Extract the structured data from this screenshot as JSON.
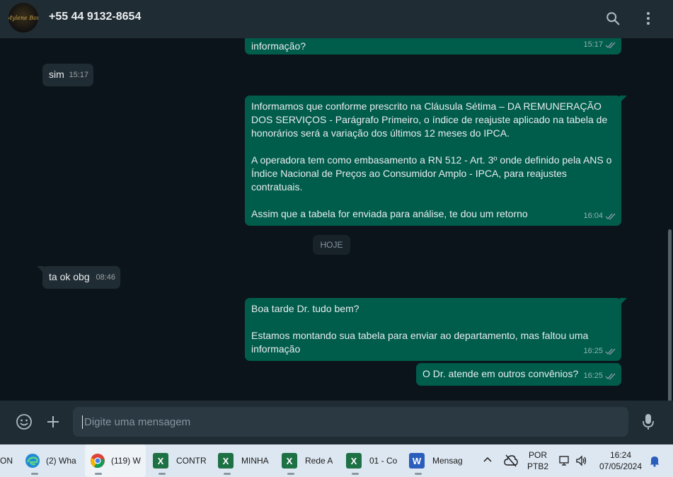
{
  "header": {
    "avatar_text": "Mylene Bou",
    "contact": "+55 44 9132-8654",
    "search_icon": "search-icon",
    "menu_icon": "kebab-menu-icon"
  },
  "messages": [
    {
      "dir": "out",
      "text": "informação?",
      "time": "15:17",
      "status": "read"
    },
    {
      "dir": "in",
      "text": "sim",
      "time": "15:17"
    },
    {
      "dir": "out",
      "text": "Informamos que conforme prescrito na Cláusula Sétima – DA REMUNERAÇÃO DOS SERVIÇOS - Parágrafo Primeiro, o índice de reajuste aplicado na tabela de honorários será a variação dos últimos 12 meses do IPCA.\n\nA operadora tem como embasamento a RN 512 - Art. 3º onde definido pela ANS o Índice Nacional de Preços ao Consumidor Amplo - IPCA, para reajustes contratuais.\n\nAssim que a tabela for enviada para análise, te dou um retorno",
      "time": "16:04",
      "status": "read"
    },
    {
      "dir": "in",
      "text": "ta ok obg",
      "time": "08:46"
    },
    {
      "dir": "out",
      "text": "Boa tarde Dr. tudo bem?\n\nEstamos montando sua tabela para enviar ao departamento, mas faltou uma informação",
      "time": "16:25",
      "status": "read"
    },
    {
      "dir": "out",
      "text": "O Dr. atende em outros convênios?",
      "time": "16:25",
      "status": "read"
    }
  ],
  "date_divider": "HOJE",
  "composer": {
    "placeholder": "Digite uma mensagem",
    "value": "",
    "emoji_icon": "emoji-icon",
    "attach_icon": "plus-icon",
    "mic_icon": "microphone-icon"
  },
  "taskbar": {
    "items": [
      {
        "label": "ON",
        "icon": "app-icon"
      },
      {
        "label": "(2) Wha",
        "icon": "edge-icon"
      },
      {
        "label": "(119) W",
        "icon": "chrome-icon",
        "active": true
      },
      {
        "label": "CONTR",
        "icon": "excel-icon"
      },
      {
        "label": "MINHA",
        "icon": "excel-icon"
      },
      {
        "label": "Rede A",
        "icon": "excel-icon"
      },
      {
        "label": "01 - Co",
        "icon": "excel-icon"
      },
      {
        "label": "Mensag",
        "icon": "word-icon"
      }
    ],
    "lang_line1": "POR",
    "lang_line2": "PTB2",
    "time": "16:24",
    "date": "07/05/2024"
  },
  "colors": {
    "outgoing_bubble": "#005c4b",
    "incoming_bubble": "#202c33",
    "chat_background": "#0b141a",
    "read_ticks": "#8696a0"
  }
}
